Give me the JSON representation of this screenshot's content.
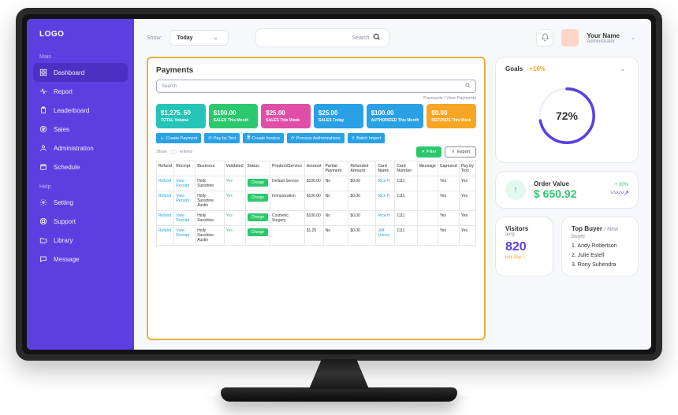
{
  "logo": "LOGO",
  "sidebar": {
    "main_label": "Main",
    "help_label": "Help",
    "main_items": [
      {
        "label": "Dashboard",
        "icon": "grid",
        "active": true
      },
      {
        "label": "Report",
        "icon": "pulse"
      },
      {
        "label": "Leaderboard",
        "icon": "clipboard"
      },
      {
        "label": "Sales",
        "icon": "circle-dollar"
      },
      {
        "label": "Administration",
        "icon": "user"
      },
      {
        "label": "Schedule",
        "icon": "calendar"
      }
    ],
    "help_items": [
      {
        "label": "Setting",
        "icon": "gear"
      },
      {
        "label": "Support",
        "icon": "life-ring"
      },
      {
        "label": "Library",
        "icon": "folder"
      },
      {
        "label": "Message",
        "icon": "chat"
      }
    ]
  },
  "topbar": {
    "show_label": "Show:",
    "show_value": "Today",
    "search_placeholder": "Search",
    "user_name": "Your Name",
    "user_role": "Administrator"
  },
  "payments": {
    "title": "Payments",
    "search_placeholder": "Search",
    "breadcrumb": "Payments / View Payments",
    "cards": [
      {
        "value": "$1,275. 50",
        "label": "TOTAL Volume",
        "color": "#26c4b8"
      },
      {
        "value": "$100.00",
        "label": "SALES This Month",
        "color": "#2cc86e"
      },
      {
        "value": "$25.00",
        "label": "SALES This Week",
        "color": "#e04fa7"
      },
      {
        "value": "$25.00",
        "label": "SALES Today",
        "color": "#2aa0e5"
      },
      {
        "value": "$100.00",
        "label": "AUTHORIZED This Month",
        "color": "#2aa0e5"
      },
      {
        "value": "$0.00",
        "label": "REFUNDS This Week",
        "color": "#f6a623"
      }
    ],
    "actions": [
      {
        "label": "Create Payment",
        "icon": "plus"
      },
      {
        "label": "Pay by Text",
        "icon": "phone"
      },
      {
        "label": "Create Invoice",
        "icon": "file"
      },
      {
        "label": "Process Authorizations",
        "icon": "refresh"
      },
      {
        "label": "Batch Import",
        "icon": "upload"
      }
    ],
    "show_entries": {
      "show": "Show",
      "count": "",
      "entries": "entries"
    },
    "filter_label": "Filter",
    "export_label": "Export",
    "headers": [
      "Refund",
      "Receipt",
      "Business",
      "Validated",
      "Status",
      "Product/Service",
      "Amount",
      "Partial Payment",
      "Refunded Amount",
      "Card Name",
      "Card Number",
      "Message",
      "Captured",
      "Pay by Text"
    ],
    "rows": [
      {
        "refund": "Refund",
        "receipt": "View Receipt",
        "business": "Holly Sunshine",
        "validated": "Yes",
        "status": "Charge",
        "product": "Default Service",
        "amount": "$100.00",
        "partial": "No",
        "refund_amt": "$0.00",
        "card_name": "Rice H",
        "card_num": "1111",
        "message": "",
        "captured": "Yes",
        "pbt": "Yes"
      },
      {
        "refund": "Refund",
        "receipt": "View Receipt",
        "business": "Holly Sunshine Austin",
        "validated": "Yes",
        "status": "Charge",
        "product": "Immunization",
        "amount": "$100.00",
        "partial": "No",
        "refund_amt": "$0.00",
        "card_name": "Rice H",
        "card_num": "1111",
        "message": "",
        "captured": "Yes",
        "pbt": "Yes"
      },
      {
        "refund": "Refund",
        "receipt": "View Receipt",
        "business": "Holly Sunshine",
        "validated": "Yes",
        "status": "Charge",
        "product": "Cosmetic Surgery",
        "amount": "$100.00",
        "partial": "No",
        "refund_amt": "$0.00",
        "card_name": "Rice H",
        "card_num": "1111",
        "message": "",
        "captured": "Yes",
        "pbt": "Yes"
      },
      {
        "refund": "Refund",
        "receipt": "View Receipt",
        "business": "Holly Sunshine Austin",
        "validated": "Yes",
        "status": "Charge",
        "product": "",
        "amount": "$1.25",
        "partial": "No",
        "refund_amt": "$0.00",
        "card_name": "Jeff Linney",
        "card_num": "1111",
        "message": "",
        "captured": "Yes",
        "pbt": "Yes"
      }
    ]
  },
  "goals": {
    "title": "Goals",
    "delta": "+16%",
    "percent_text": "72%",
    "percent": 72
  },
  "order": {
    "label": "Order Value",
    "value": "$ 650.92",
    "change": "+ 20%"
  },
  "visitors": {
    "title": "Visitors",
    "sub": "avrg",
    "value": "820",
    "perday": "per day"
  },
  "topbuyer": {
    "title": "Top Buyer",
    "sub": "New buyer",
    "items": [
      "1. Andy Robertson",
      "2. Julie Estell",
      "3. Rony Suhendra"
    ]
  }
}
